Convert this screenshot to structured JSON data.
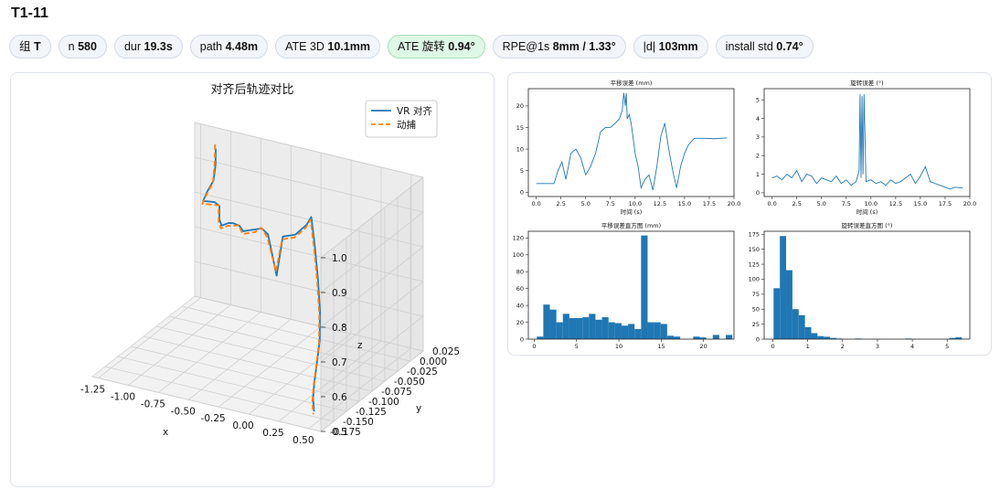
{
  "page": {
    "title": "T1-11"
  },
  "stats": [
    {
      "label": "组",
      "value": "T"
    },
    {
      "label": "n",
      "value": "580"
    },
    {
      "label": "dur",
      "value": "19.3s"
    },
    {
      "label": "path",
      "value": "4.48m"
    },
    {
      "label": "ATE 3D",
      "value": "10.1mm"
    },
    {
      "label": "ATE 旋转",
      "value": "0.94°",
      "highlight": true
    },
    {
      "label": "RPE@1s",
      "value": "8mm / 1.33°"
    },
    {
      "label": "|d|",
      "value": "103mm"
    },
    {
      "label": "install std",
      "value": "0.74°"
    }
  ],
  "colors": {
    "series_blue": "#1f77b4",
    "series_orange": "#ff7f0e",
    "ok_bg": "#def7e6",
    "chip_bg": "#f2f5f9"
  },
  "chart_data": [
    {
      "type": "line3d",
      "title": "对齐后轨迹对比",
      "xlabel": "x",
      "ylabel": "y",
      "zlabel": "z",
      "x_ticks": [
        "-1.25",
        "-1.00",
        "-0.75",
        "-0.50",
        "-0.25",
        "0.00",
        "0.25",
        "0.50"
      ],
      "y_ticks": [
        "0.025",
        "0.000",
        "-0.025",
        "-0.050",
        "-0.075",
        "-0.100",
        "-0.125",
        "-0.150",
        "-0.175"
      ],
      "z_ticks": [
        "0.5",
        "0.6",
        "0.7",
        "0.8",
        "0.9",
        "1.0"
      ],
      "xlim": [
        -1.3,
        0.6
      ],
      "ylim": [
        -0.175,
        0.025
      ],
      "zlim": [
        0.5,
        1.0
      ],
      "legend_position": "top-right",
      "series": [
        {
          "name": "VR 对齐",
          "style": "solid",
          "color": "#1f77b4",
          "x": [
            -1.04,
            -1.02,
            -1.02,
            -1.05,
            -1.06,
            -1.0,
            -0.92,
            -0.86,
            -0.84,
            -0.8,
            -0.72,
            -0.66,
            -0.6,
            -0.56,
            -0.5,
            -0.44,
            -0.38,
            -0.32,
            -0.24,
            -0.18,
            -0.12,
            -0.06,
            0.02,
            0.1,
            0.18,
            0.25,
            0.32,
            0.38,
            0.42,
            0.44,
            0.44,
            0.45,
            0.48
          ],
          "y": [
            0.005,
            0.0,
            -0.004,
            -0.01,
            -0.015,
            -0.02,
            -0.025,
            -0.03,
            -0.035,
            -0.04,
            -0.045,
            -0.05,
            -0.052,
            -0.054,
            -0.056,
            -0.058,
            -0.06,
            -0.062,
            -0.064,
            -0.066,
            -0.068,
            -0.07,
            -0.075,
            -0.085,
            -0.095,
            -0.105,
            -0.115,
            -0.125,
            -0.135,
            -0.145,
            -0.15,
            -0.155,
            -0.16
          ],
          "z": [
            0.97,
            0.93,
            0.89,
            0.86,
            0.84,
            0.85,
            0.86,
            0.86,
            0.83,
            0.82,
            0.84,
            0.85,
            0.85,
            0.84,
            0.85,
            0.86,
            0.87,
            0.86,
            0.75,
            0.87,
            0.88,
            0.89,
            0.92,
            0.95,
            0.99,
            0.93,
            0.85,
            0.77,
            0.7,
            0.65,
            0.6,
            0.56,
            0.53
          ]
        },
        {
          "name": "动捕",
          "style": "dashed",
          "color": "#ff7f0e",
          "x": [
            -1.05,
            -1.03,
            -1.03,
            -1.06,
            -1.07,
            -1.01,
            -0.93,
            -0.87,
            -0.85,
            -0.81,
            -0.73,
            -0.67,
            -0.61,
            -0.57,
            -0.51,
            -0.45,
            -0.39,
            -0.33,
            -0.25,
            -0.19,
            -0.13,
            -0.07,
            0.01,
            0.09,
            0.17,
            0.24,
            0.31,
            0.37,
            0.41,
            0.43,
            0.43,
            0.44,
            0.47
          ],
          "y": [
            0.006,
            0.001,
            -0.003,
            -0.009,
            -0.014,
            -0.019,
            -0.024,
            -0.029,
            -0.034,
            -0.039,
            -0.044,
            -0.049,
            -0.051,
            -0.053,
            -0.055,
            -0.057,
            -0.059,
            -0.061,
            -0.063,
            -0.065,
            -0.067,
            -0.069,
            -0.074,
            -0.084,
            -0.094,
            -0.104,
            -0.114,
            -0.124,
            -0.134,
            -0.144,
            -0.149,
            -0.154,
            -0.159
          ],
          "z": [
            0.98,
            0.94,
            0.88,
            0.85,
            0.83,
            0.84,
            0.85,
            0.86,
            0.82,
            0.81,
            0.83,
            0.84,
            0.85,
            0.83,
            0.84,
            0.85,
            0.87,
            0.85,
            0.76,
            0.86,
            0.87,
            0.88,
            0.91,
            0.94,
            0.98,
            0.92,
            0.84,
            0.76,
            0.69,
            0.64,
            0.59,
            0.55,
            0.52
          ]
        }
      ]
    },
    {
      "type": "line",
      "title": "平移误差 (mm)",
      "xlabel": "时间 (s)",
      "ylabel": "",
      "xlim": [
        -0.8,
        20
      ],
      "ylim": [
        -1,
        24
      ],
      "x_ticks": [
        0.0,
        2.5,
        5.0,
        7.5,
        10.0,
        12.5,
        15.0,
        17.5,
        20.0
      ],
      "y_ticks": [
        0,
        5,
        10,
        15,
        20
      ],
      "series": [
        {
          "color": "#1f77b4",
          "x": [
            0,
            1,
            1.8,
            2.2,
            2.6,
            3.0,
            3.5,
            4.0,
            4.5,
            5.0,
            5.5,
            6.0,
            6.5,
            7.0,
            7.5,
            8.0,
            8.4,
            8.7,
            8.85,
            9.0,
            9.1,
            9.2,
            9.4,
            9.6,
            10.0,
            10.3,
            10.6,
            11.0,
            11.4,
            11.8,
            12.2,
            12.6,
            13.0,
            13.4,
            13.8,
            14.2,
            14.6,
            15.0,
            15.4,
            16,
            17,
            18,
            19.3
          ],
          "y": [
            2,
            2,
            2,
            5,
            7,
            3,
            9,
            10,
            8,
            4,
            6,
            9,
            14,
            15,
            15,
            16,
            17,
            19,
            23,
            20,
            23,
            17,
            18,
            16,
            9,
            6,
            1,
            3,
            4,
            0.5,
            6,
            13,
            16,
            10,
            5,
            1,
            6,
            9,
            11,
            12.5,
            12.5,
            12.4,
            12.6
          ]
        }
      ]
    },
    {
      "type": "line",
      "title": "旋转误差 (°)",
      "xlabel": "时间 (s)",
      "ylabel": "",
      "xlim": [
        -0.8,
        20
      ],
      "ylim": [
        -0.2,
        5.6
      ],
      "x_ticks": [
        0.0,
        2.5,
        5.0,
        7.5,
        10.0,
        12.5,
        15.0,
        17.5,
        20.0
      ],
      "y_ticks": [
        0,
        1,
        2,
        3,
        4,
        5
      ],
      "series": [
        {
          "color": "#1f77b4",
          "x": [
            0,
            0.5,
            1.0,
            1.5,
            2.0,
            2.5,
            3.0,
            3.5,
            4.0,
            4.5,
            5.0,
            5.5,
            6.0,
            6.5,
            7.0,
            7.5,
            8.0,
            8.5,
            8.8,
            8.9,
            9.0,
            9.1,
            9.2,
            9.3,
            9.5,
            10.0,
            10.5,
            11.0,
            11.5,
            12.0,
            12.5,
            13.0,
            13.5,
            14.0,
            14.5,
            15.0,
            15.5,
            16.0,
            16.5,
            17.0,
            17.5,
            18.0,
            18.5,
            19.3
          ],
          "y": [
            0.8,
            0.9,
            0.7,
            1.0,
            0.8,
            1.2,
            0.6,
            1.0,
            0.9,
            0.5,
            0.8,
            0.7,
            0.6,
            0.9,
            0.5,
            0.7,
            0.4,
            0.6,
            1.2,
            5.3,
            0.8,
            5.2,
            1.0,
            5.3,
            0.6,
            0.7,
            0.5,
            0.6,
            0.4,
            0.7,
            0.5,
            0.6,
            0.8,
            1.0,
            0.5,
            0.9,
            1.4,
            0.6,
            0.5,
            0.4,
            0.3,
            0.2,
            0.3,
            0.25
          ]
        }
      ]
    },
    {
      "type": "bar",
      "title": "平移误差直方图 (mm)",
      "xlabel": "",
      "ylabel": "",
      "xlim": [
        -0.7,
        23.6
      ],
      "ylim": [
        0,
        128
      ],
      "x_ticks": [
        0,
        5,
        10,
        15,
        20
      ],
      "y_ticks": [
        0,
        20,
        40,
        60,
        80,
        100,
        120
      ],
      "bin_start": 0.3,
      "bin_width": 0.77,
      "values": [
        3,
        41,
        35,
        20,
        30,
        25,
        25,
        26,
        30,
        23,
        26,
        20,
        19,
        16,
        18,
        12,
        123,
        20,
        20,
        18,
        4,
        3,
        0,
        0,
        3,
        2,
        0,
        5,
        0,
        5
      ]
    },
    {
      "type": "bar",
      "title": "旋转误差直方图 (°)",
      "xlabel": "",
      "ylabel": "",
      "xlim": [
        -0.25,
        5.65
      ],
      "ylim": [
        0,
        180
      ],
      "x_ticks": [
        0,
        1,
        2,
        3,
        4,
        5
      ],
      "y_ticks": [
        0,
        25,
        50,
        75,
        100,
        125,
        150,
        175
      ],
      "bin_start": 0.02,
      "bin_width": 0.18,
      "values": [
        85,
        172,
        115,
        50,
        40,
        20,
        10,
        5,
        4,
        2,
        1,
        0,
        0,
        1,
        0,
        0,
        0,
        0,
        0,
        0,
        0,
        1,
        0,
        0,
        0,
        0,
        0,
        0,
        2,
        3
      ]
    }
  ]
}
